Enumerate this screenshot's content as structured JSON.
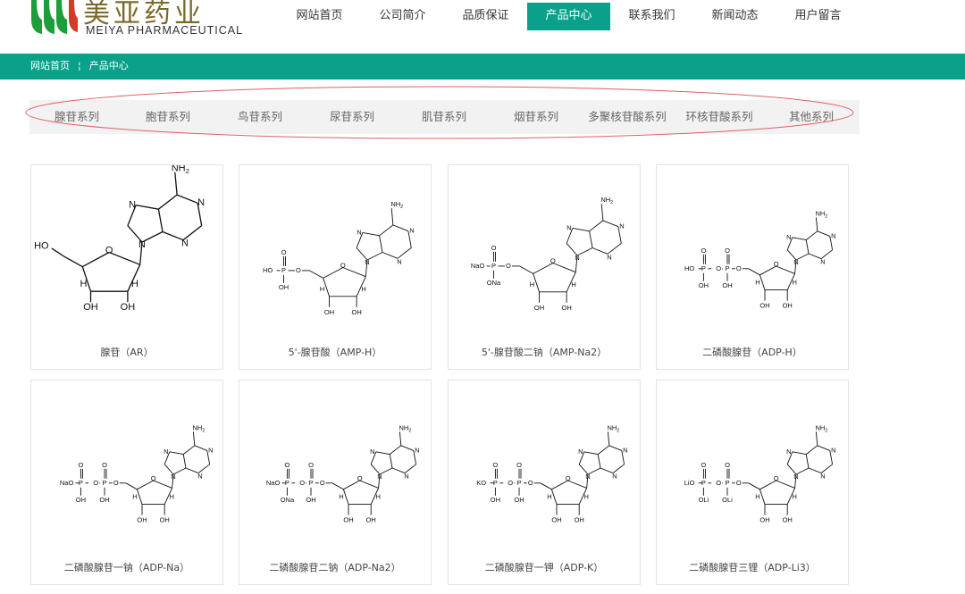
{
  "header": {
    "logo_cn": "美亚药业",
    "logo_en": "MEIYA PHARMACEUTICAL",
    "nav": [
      {
        "label": "网站首页",
        "active": false
      },
      {
        "label": "公司简介",
        "active": false
      },
      {
        "label": "品质保证",
        "active": false
      },
      {
        "label": "产品中心",
        "active": true
      },
      {
        "label": "联系我们",
        "active": false
      },
      {
        "label": "新闻动态",
        "active": false
      },
      {
        "label": "用户留言",
        "active": false
      }
    ]
  },
  "breadcrumb": {
    "home": "网站首页",
    "separator": "¦",
    "current": "产品中心"
  },
  "categories": [
    "腺苷系列",
    "胞苷系列",
    "鸟苷系列",
    "尿苷系列",
    "肌苷系列",
    "烟苷系列",
    "多聚核苷酸系列",
    "环核苷酸系列",
    "其他系列"
  ],
  "colors": {
    "accent": "#0aa089",
    "annotation": "#e06060"
  },
  "products": [
    {
      "name": "腺苷（AR）",
      "phosphates": 0,
      "counter": []
    },
    {
      "name": "5'-腺苷酸（AMP-H）",
      "phosphates": 1,
      "counter": [
        "HO",
        "OH"
      ]
    },
    {
      "name": "5'-腺苷酸二钠（AMP-Na2）",
      "phosphates": 1,
      "counter": [
        "NaO",
        "ONa"
      ]
    },
    {
      "name": "二磷酸腺苷（ADP-H）",
      "phosphates": 2,
      "counter": [
        "HO",
        "OH",
        "OH"
      ]
    },
    {
      "name": "二磷酸腺苷一钠（ADP-Na）",
      "phosphates": 2,
      "counter": [
        "NaO",
        "OH",
        "OH"
      ]
    },
    {
      "name": "二磷酸腺苷二钠（ADP-Na2）",
      "phosphates": 2,
      "counter": [
        "NaO",
        "ONa",
        "OH"
      ]
    },
    {
      "name": "二磷酸腺苷一钾（ADP-K）",
      "phosphates": 2,
      "counter": [
        "KO",
        "OH",
        "OH"
      ]
    },
    {
      "name": "二磷酸腺苷三锂（ADP-Li3）",
      "phosphates": 2,
      "counter": [
        "LiO",
        "OLi",
        "OLi"
      ]
    }
  ]
}
